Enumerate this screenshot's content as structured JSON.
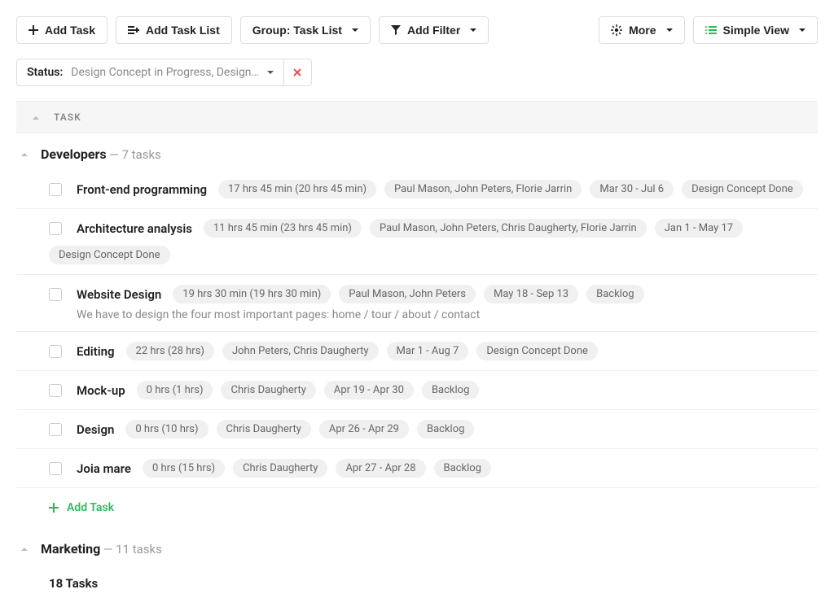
{
  "toolbar": {
    "add_task": "Add Task",
    "add_task_list": "Add Task List",
    "group": "Group: Task List",
    "add_filter": "Add Filter",
    "more": "More",
    "simple_view": "Simple View"
  },
  "filter": {
    "label": "Status:",
    "value": "Design Concept in Progress, Design…"
  },
  "table": {
    "col_task": "TASK"
  },
  "groups": [
    {
      "name": "Developers",
      "meta": "— 7 tasks",
      "tasks": [
        {
          "name": "Front-end programming",
          "time": "17 hrs 45 min (20 hrs 45 min)",
          "people": "Paul Mason, John Peters, Florie Jarrin",
          "dates": "Mar 30 - Jul 6",
          "status": "Design Concept Done"
        },
        {
          "name": "Architecture analysis",
          "time": "11 hrs 45 min (23 hrs 45 min)",
          "people": "Paul Mason, John Peters, Chris Daugherty, Florie Jarrin",
          "dates": "Jan 1 - May 17",
          "status": "Design Concept Done"
        },
        {
          "name": "Website Design",
          "time": "19 hrs 30 min (19 hrs 30 min)",
          "people": "Paul Mason, John Peters",
          "dates": "May 18 - Sep 13",
          "status": "Backlog",
          "desc": "We have to design the four most important pages: home / tour / about / contact"
        },
        {
          "name": "Editing",
          "time": "22 hrs (28 hrs)",
          "people": "John Peters, Chris Daugherty",
          "dates": "Mar 1 - Aug 7",
          "status": "Design Concept Done"
        },
        {
          "name": "Mock-up",
          "time": "0 hrs (1 hrs)",
          "people": "Chris Daugherty",
          "dates": "Apr 19 - Apr 30",
          "status": "Backlog"
        },
        {
          "name": "Design",
          "time": "0 hrs (10 hrs)",
          "people": "Chris Daugherty",
          "dates": "Apr 26 - Apr 29",
          "status": "Backlog"
        },
        {
          "name": "Joia mare",
          "time": "0 hrs (15 hrs)",
          "people": "Chris Daugherty",
          "dates": "Apr 27 - Apr 28",
          "status": "Backlog"
        }
      ],
      "add_task": "Add Task"
    },
    {
      "name": "Marketing",
      "meta": "— 11 tasks",
      "tasks": []
    }
  ],
  "total": "18 Tasks"
}
